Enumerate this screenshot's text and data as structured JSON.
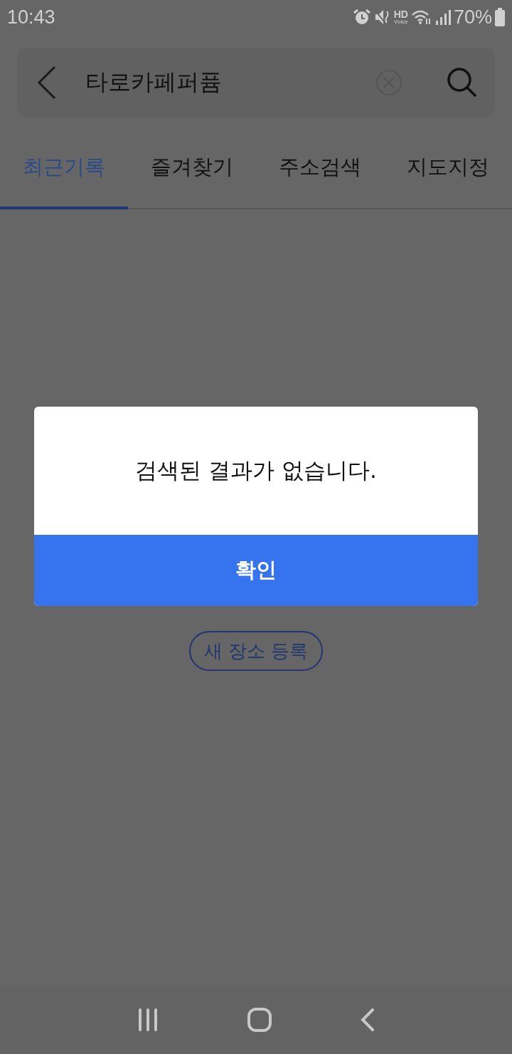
{
  "status_bar": {
    "time": "10:43",
    "hd_label": "HD",
    "voice_label": "Voice",
    "battery": "70%"
  },
  "search": {
    "value": "타로카페퍼퓸"
  },
  "tabs": [
    {
      "label": "최근기록",
      "selected": true
    },
    {
      "label": "즐겨찾기",
      "selected": false
    },
    {
      "label": "주소검색",
      "selected": false
    },
    {
      "label": "지도지정",
      "selected": false
    }
  ],
  "new_place_button": "새 장소 등록",
  "dialog": {
    "message": "검색된 결과가 없습니다.",
    "confirm": "확인"
  }
}
